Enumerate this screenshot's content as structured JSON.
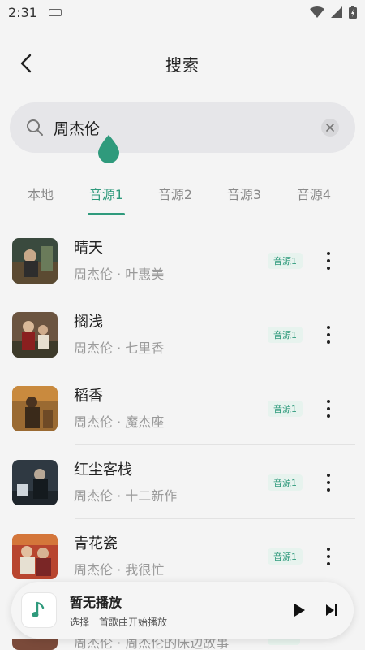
{
  "status_bar": {
    "time": "2:31"
  },
  "header": {
    "title": "搜索"
  },
  "search": {
    "query": "周杰伦"
  },
  "tabs": [
    {
      "label": "本地"
    },
    {
      "label": "音源1"
    },
    {
      "label": "音源2"
    },
    {
      "label": "音源3"
    },
    {
      "label": "音源4"
    }
  ],
  "songs": [
    {
      "title": "晴天",
      "subtitle": "周杰伦 · 叶惠美",
      "source": "音源1"
    },
    {
      "title": "搁浅",
      "subtitle": "周杰伦 · 七里香",
      "source": "音源1"
    },
    {
      "title": "稻香",
      "subtitle": "周杰伦 · 魔杰座",
      "source": "音源1"
    },
    {
      "title": "红尘客栈",
      "subtitle": "周杰伦 · 十二新作",
      "source": "音源1"
    },
    {
      "title": "青花瓷",
      "subtitle": "周杰伦 · 我很忙",
      "source": "音源1"
    }
  ],
  "partial_song": {
    "subtitle": "周杰伦 · 周杰伦的床边故事"
  },
  "player": {
    "title": "暂无播放",
    "subtitle": "选择一首歌曲开始播放"
  },
  "colors": {
    "accent": "#2f9a7c",
    "background": "#f4f4f4",
    "search_bg": "#e6e6e9"
  }
}
